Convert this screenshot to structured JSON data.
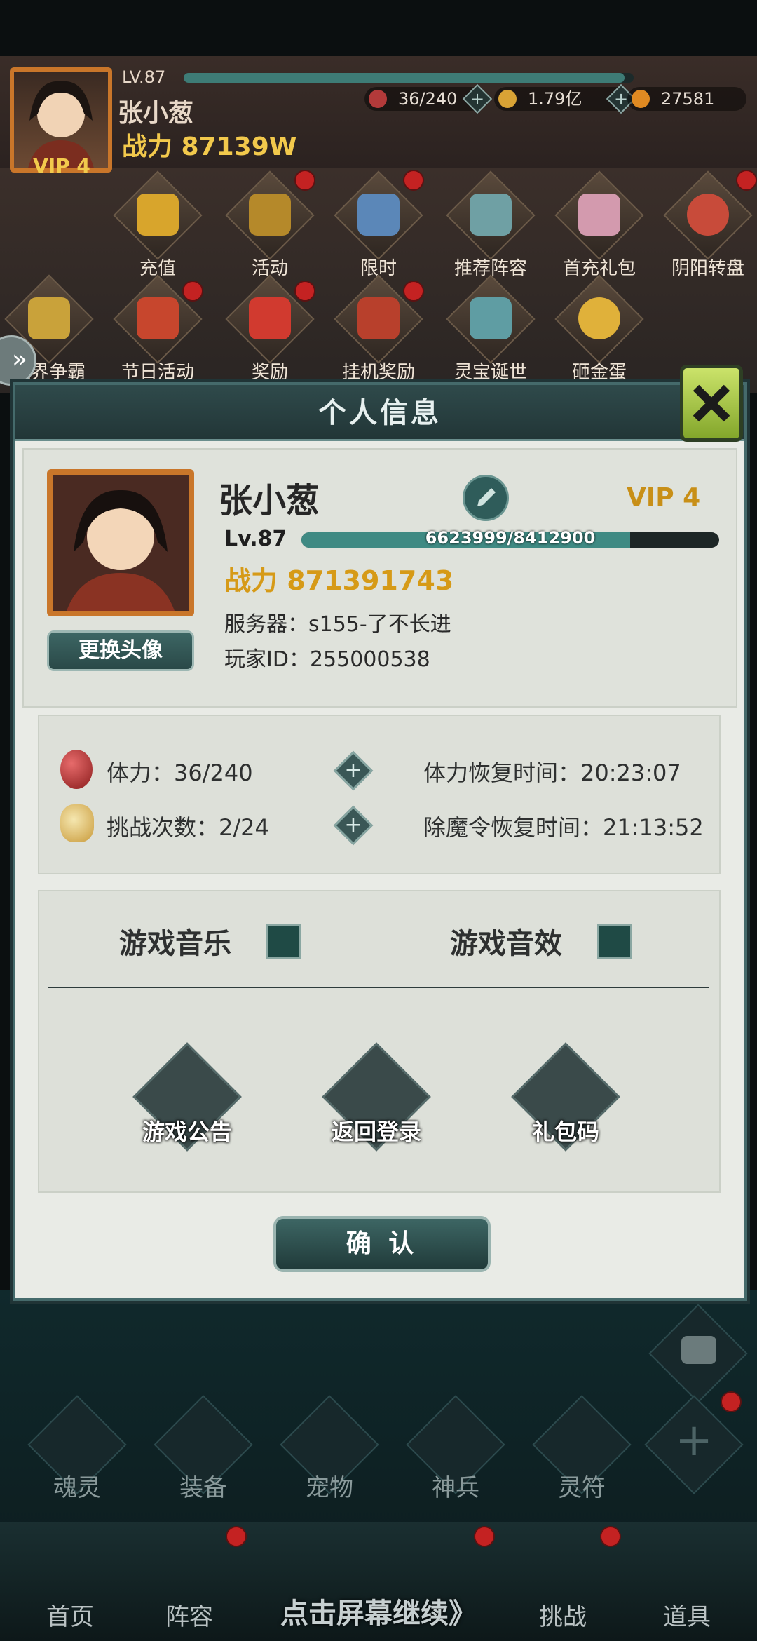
{
  "header": {
    "level": "LV.87",
    "name": "张小葱",
    "power": "战力 87139W",
    "vip": "VIP 4",
    "stamina": "36/240",
    "gold": "1.79亿",
    "gems": "27581"
  },
  "activities_row1": [
    {
      "label": "充值"
    },
    {
      "label": "活动"
    },
    {
      "label": "限时"
    },
    {
      "label": "推荐阵容"
    },
    {
      "label": "首充礼包"
    },
    {
      "label": "阴阳转盘"
    }
  ],
  "activities_row2": [
    {
      "label": "境界争霸"
    },
    {
      "label": "节日活动"
    },
    {
      "label": "奖励"
    },
    {
      "label": "挂机奖励"
    },
    {
      "label": "灵宝诞世"
    },
    {
      "label": "砸金蛋"
    }
  ],
  "dialog": {
    "title": "个人信息",
    "close_icon_name": "close-icon",
    "player_name": "张小葱",
    "vip": "VIP 4",
    "level": "Lv.87",
    "exp_text": "6623999/8412900",
    "exp_fraction": 0.787,
    "power": "战力 871391743",
    "server": "服务器：s155-了不长进",
    "player_id": "玩家ID：255000538",
    "change_avatar": "更换头像",
    "stamina_label": "体力：36/240",
    "challenge_label": "挑战次数：2/24",
    "stamina_recover": "体力恢复时间：20:23:07",
    "token_recover": "除魔令恢复时间：21:13:52",
    "music_label": "游戏音乐",
    "sfx_label": "游戏音效",
    "btn_notice": "游戏公告",
    "btn_relogin": "返回登录",
    "btn_giftcode": "礼包码",
    "confirm": "确 认"
  },
  "bottom_nav_row1": [
    {
      "label": "魂灵"
    },
    {
      "label": "装备"
    },
    {
      "label": "宠物"
    },
    {
      "label": "神兵"
    },
    {
      "label": "灵符"
    }
  ],
  "bottom_nav_row2": [
    {
      "label": "首页"
    },
    {
      "label": "阵容"
    },
    {
      "label": "挑战"
    },
    {
      "label": "道具"
    }
  ],
  "continue_hint": "点击屏幕继续》",
  "colors": {
    "accent_teal": "#2f4a4b",
    "exp_fill": "#3f8a83",
    "power_gold": "#f2c94c",
    "badge_red": "#c42222"
  }
}
